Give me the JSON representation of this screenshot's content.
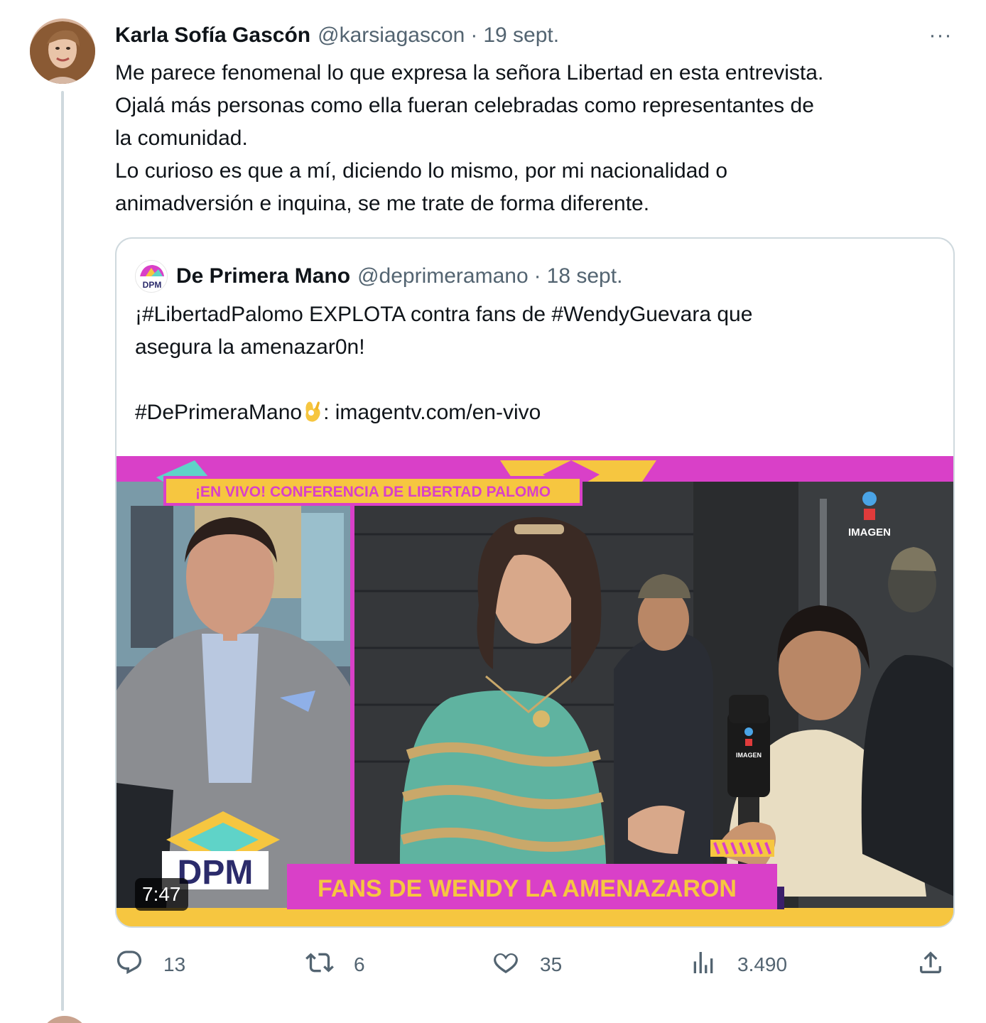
{
  "tweet": {
    "author_name": "Karla Sofía Gascón",
    "handle": "@karsiagascon",
    "separator": "·",
    "date": "19 sept.",
    "more_label": "···",
    "text_lines": [
      "Me parece fenomenal lo que expresa la señora Libertad en esta entrevista.",
      "Ojalá más personas como ella fueran celebradas como representantes de",
      "la comunidad.",
      "Lo curioso es que a mí, diciendo lo mismo, por mi nacionalidad o",
      "animadversión e inquina, se me trate de forma diferente."
    ]
  },
  "quoted": {
    "author_name": "De Primera Mano",
    "handle": "@deprimeramano",
    "separator": "·",
    "date": "18 sept.",
    "avatar_text": "DPM",
    "line1": "¡#LibertadPalomo EXPLOTA contra fans de #WendyGuevara que",
    "line2": "asegura la amenazar0n!",
    "hashtag": "#DePrimeraMano",
    "emoji_icon": "ok-hand-emoji",
    "link_text": ": imagentv.com/en-vivo",
    "video": {
      "duration": "7:47",
      "banner_top": "¡EN VIVO! CONFERENCIA DE LIBERTAD PALOMO",
      "banner_bottom": "FANS DE WENDY LA AMENAZARON",
      "logo_text": "DPM",
      "network_text": "IMAGEN",
      "mic_text": "IMAGEN"
    }
  },
  "actions": {
    "reply_count": "13",
    "retweet_count": "6",
    "like_count": "35",
    "views_count": "3.490"
  },
  "colors": {
    "text_primary": "#0f1419",
    "text_secondary": "#536471",
    "border": "#cfd9de",
    "magenta": "#d940c8",
    "yellow": "#f6c640"
  }
}
